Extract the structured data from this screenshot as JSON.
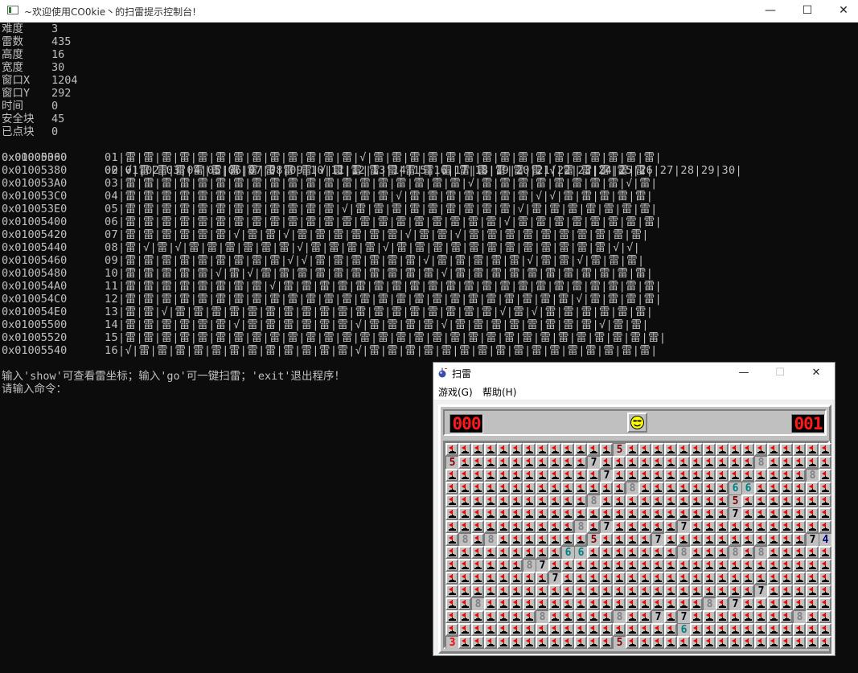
{
  "console": {
    "title": "~欢迎使用CO0kie丶的扫雷提示控制台!",
    "minimize": "—",
    "maximize": "☐",
    "close": "✕",
    "info": [
      {
        "label": "难度",
        "value": "3"
      },
      {
        "label": "雷数",
        "value": "435"
      },
      {
        "label": "高度",
        "value": "16"
      },
      {
        "label": "宽度",
        "value": "30"
      },
      {
        "label": "窗口X",
        "value": "1204"
      },
      {
        "label": "窗口Y",
        "value": "292"
      },
      {
        "label": "时间",
        "value": "0"
      },
      {
        "label": "安全块",
        "value": "45"
      },
      {
        "label": "已点块",
        "value": "0"
      }
    ],
    "grid_header": {
      "address": "0x00000000",
      "cells": "00|01|02|03|04|05|06|07|08|09|10|11|12|13|14|15|16|17|18|19|20|21|22|23|24|25|26|27|28|29|30|"
    },
    "grid_rows": [
      {
        "address": "0x01005360",
        "cells": "01|雷|雷|雷|雷|雷|雷|雷|雷|雷|雷|雷|雷|雷|√|雷|雷|雷|雷|雷|雷|雷|雷|雷|雷|雷|雷|雷|雷|雷|雷|"
      },
      {
        "address": "0x01005380",
        "cells": "02|√|雷|雷|雷|雷|雷|雷|雷|雷|雷|雷|√|雷|雷|雷|雷|雷|雷|雷|雷|雷|雷|雷|雷|√|雷|雷|雷|雷|雷|"
      },
      {
        "address": "0x010053A0",
        "cells": "03|雷|雷|雷|雷|雷|雷|雷|雷|雷|雷|雷|雷|雷|雷|雷|雷|雷|雷|雷|√|雷|雷|雷|雷|雷|雷|雷|雷|√|雷|"
      },
      {
        "address": "0x010053C0",
        "cells": "04|雷|雷|雷|雷|雷|雷|雷|雷|雷|雷|雷|雷|雷|雷|雷|√|雷|雷|雷|雷|雷|雷|雷|√|√|雷|雷|雷|雷|雷|"
      },
      {
        "address": "0x010053E0",
        "cells": "05|雷|雷|雷|雷|雷|雷|雷|雷|雷|雷|雷|雷|√|雷|雷|雷|雷|雷|雷|雷|雷|雷|√|雷|雷|雷|雷|雷|雷|雷|"
      },
      {
        "address": "0x01005400",
        "cells": "06|雷|雷|雷|雷|雷|雷|雷|雷|雷|雷|雷|雷|雷|雷|雷|雷|雷|雷|雷|雷|雷|√|雷|雷|雷|雷|雷|雷|雷|雷|"
      },
      {
        "address": "0x01005420",
        "cells": "07|雷|雷|雷|雷|雷|雷|√|雷|雷|√|雷|雷|雷|雷|雷|雷|√|雷|雷|√|雷|雷|雷|雷|雷|雷|雷|雷|雷|雷|"
      },
      {
        "address": "0x01005440",
        "cells": "08|雷|√|雷|√|雷|雷|雷|雷|雷|雷|√|雷|雷|雷|雷|√|雷|雷|雷|雷|雷|雷|雷|雷|雷|雷|雷|雷|√|√|"
      },
      {
        "address": "0x01005460",
        "cells": "09|雷|雷|雷|雷|雷|雷|雷|雷|雷|√|√|雷|雷|雷|雷|雷|雷|√|雷|雷|雷|雷|雷|√|雷|雷|√|雷|雷|雷|"
      },
      {
        "address": "0x01005480",
        "cells": "10|雷|雷|雷|雷|雷|√|雷|√|雷|雷|雷|雷|雷|雷|雷|雷|雷|雷|√|雷|雷|雷|雷|雷|雷|雷|雷|雷|雷|雷|"
      },
      {
        "address": "0x010054A0",
        "cells": "11|雷|雷|雷|雷|雷|雷|雷|雷|√|雷|雷|雷|雷|雷|雷|雷|雷|雷|雷|雷|雷|雷|雷|雷|雷|雷|雷|雷|雷|雷|"
      },
      {
        "address": "0x010054C0",
        "cells": "12|雷|雷|雷|雷|雷|雷|雷|雷|雷|雷|雷|雷|雷|雷|雷|雷|雷|雷|雷|雷|雷|雷|雷|雷|雷|√|雷|雷|雷|雷|"
      },
      {
        "address": "0x010054E0",
        "cells": "13|雷|雷|√|雷|雷|雷|雷|雷|雷|雷|雷|雷|雷|雷|雷|雷|雷|雷|雷|雷|雷|√|雷|√|雷|雷|雷|雷|雷|雷|"
      },
      {
        "address": "0x01005500",
        "cells": "14|雷|雷|雷|雷|雷|雷|√|雷|雷|雷|雷|雷|雷|√|雷|雷|雷|雷|√|雷|雷|雷|雷|雷|雷|雷|雷|√|雷|雷|"
      },
      {
        "address": "0x01005520",
        "cells": "15|雷|雷|雷|雷|雷|雷|雷|雷|雷|雷|雷|雷|雷|雷|雷|雷|雷|雷|雷|雷|雷|雷|雷|雷|雷|雷|雷|雷|雷|雷|"
      },
      {
        "address": "0x01005540",
        "cells": "16|√|雷|雷|雷|雷|雷|雷|雷|雷|雷|雷|雷|雷|√|雷|雷|雷|雷|雷|雷|雷|雷|雷|雷|雷|雷|雷|雷|雷|雷|"
      }
    ],
    "prompt_line": "输入'show'可查看雷坐标；输入'go'可一键扫雷；'exit'退出程序！",
    "input_line": "请输入命令："
  },
  "minesweeper": {
    "title": "扫雷",
    "minimize": "—",
    "maximize": "☐",
    "close": "✕",
    "menu": [
      "游戏(G)",
      "帮助(H)"
    ],
    "mine_counter": "000",
    "timer": "001",
    "face_icon": "smiley-face-icon",
    "flag_icon": "flag-icon",
    "number_colors": {
      "3": "#ff0000",
      "4": "#000080",
      "5": "#800000",
      "6": "#008080",
      "7": "#000000",
      "8": "#808080"
    },
    "board_rows": [
      [
        "F",
        "F",
        "F",
        "F",
        "F",
        "F",
        "F",
        "F",
        "F",
        "F",
        "F",
        "F",
        "F",
        "5",
        "F",
        "F",
        "F",
        "F",
        "F",
        "F",
        "F",
        "F",
        "F",
        "F",
        "F",
        "F",
        "F",
        "F",
        "F",
        "F"
      ],
      [
        "5",
        "F",
        "F",
        "F",
        "F",
        "F",
        "F",
        "F",
        "F",
        "F",
        "F",
        "7",
        "F",
        "F",
        "F",
        "F",
        "F",
        "F",
        "F",
        "F",
        "F",
        "F",
        "F",
        "F",
        "8",
        "F",
        "F",
        "F",
        "F",
        "F"
      ],
      [
        "F",
        "F",
        "F",
        "F",
        "F",
        "F",
        "F",
        "F",
        "F",
        "F",
        "F",
        "F",
        "7",
        "F",
        "F",
        "F",
        "F",
        "F",
        "F",
        "F",
        "F",
        "F",
        "F",
        "F",
        "F",
        "F",
        "F",
        "F",
        "8",
        "F"
      ],
      [
        "F",
        "F",
        "F",
        "F",
        "F",
        "F",
        "F",
        "F",
        "F",
        "F",
        "F",
        "F",
        "F",
        "F",
        "8",
        "F",
        "F",
        "F",
        "F",
        "F",
        "F",
        "F",
        "6",
        "6",
        "F",
        "F",
        "F",
        "F",
        "F",
        "F"
      ],
      [
        "F",
        "F",
        "F",
        "F",
        "F",
        "F",
        "F",
        "F",
        "F",
        "F",
        "F",
        "8",
        "F",
        "F",
        "F",
        "F",
        "F",
        "F",
        "F",
        "F",
        "F",
        "F",
        "5",
        "F",
        "F",
        "F",
        "F",
        "F",
        "F",
        "F"
      ],
      [
        "F",
        "F",
        "F",
        "F",
        "F",
        "F",
        "F",
        "F",
        "F",
        "F",
        "F",
        "F",
        "F",
        "F",
        "F",
        "F",
        "F",
        "F",
        "F",
        "F",
        "F",
        "F",
        "7",
        "F",
        "F",
        "F",
        "F",
        "F",
        "F",
        "F"
      ],
      [
        "F",
        "F",
        "F",
        "F",
        "F",
        "F",
        "F",
        "F",
        "F",
        "F",
        "8",
        "F",
        "7",
        "F",
        "F",
        "F",
        "F",
        "F",
        "7",
        "F",
        "F",
        "F",
        "F",
        "F",
        "F",
        "F",
        "F",
        "F",
        "F",
        "F"
      ],
      [
        "F",
        "8",
        "F",
        "8",
        "F",
        "F",
        "F",
        "F",
        "F",
        "F",
        "F",
        "5",
        "F",
        "F",
        "F",
        "F",
        "7",
        "F",
        "F",
        "F",
        "F",
        "F",
        "F",
        "F",
        "F",
        "F",
        "F",
        "F",
        "7",
        "4"
      ],
      [
        "F",
        "F",
        "F",
        "F",
        "F",
        "F",
        "F",
        "F",
        "F",
        "6",
        "6",
        "F",
        "F",
        "F",
        "F",
        "F",
        "F",
        "F",
        "8",
        "F",
        "F",
        "F",
        "8",
        "F",
        "8",
        "F",
        "F",
        "F",
        "F",
        "F"
      ],
      [
        "F",
        "F",
        "F",
        "F",
        "F",
        "F",
        "8",
        "7",
        "F",
        "F",
        "F",
        "F",
        "F",
        "F",
        "F",
        "F",
        "F",
        "F",
        "F",
        "F",
        "F",
        "F",
        "F",
        "F",
        "F",
        "F",
        "F",
        "F",
        "F",
        "F"
      ],
      [
        "F",
        "F",
        "F",
        "F",
        "F",
        "F",
        "F",
        "F",
        "7",
        "F",
        "F",
        "F",
        "F",
        "F",
        "F",
        "F",
        "F",
        "F",
        "F",
        "F",
        "F",
        "F",
        "F",
        "F",
        "F",
        "F",
        "F",
        "F",
        "F",
        "F"
      ],
      [
        "F",
        "F",
        "F",
        "F",
        "F",
        "F",
        "F",
        "F",
        "F",
        "F",
        "F",
        "F",
        "F",
        "F",
        "F",
        "F",
        "F",
        "F",
        "F",
        "F",
        "F",
        "F",
        "F",
        "F",
        "7",
        "F",
        "F",
        "F",
        "F",
        "F"
      ],
      [
        "F",
        "F",
        "8",
        "F",
        "F",
        "F",
        "F",
        "F",
        "F",
        "F",
        "F",
        "F",
        "F",
        "F",
        "F",
        "F",
        "F",
        "F",
        "F",
        "F",
        "8",
        "F",
        "7",
        "F",
        "F",
        "F",
        "F",
        "F",
        "F",
        "F"
      ],
      [
        "F",
        "F",
        "F",
        "F",
        "F",
        "F",
        "F",
        "8",
        "F",
        "F",
        "F",
        "F",
        "F",
        "8",
        "F",
        "F",
        "7",
        "F",
        "7",
        "F",
        "F",
        "F",
        "F",
        "F",
        "F",
        "F",
        "F",
        "8",
        "F",
        "F"
      ],
      [
        "F",
        "F",
        "F",
        "F",
        "F",
        "F",
        "F",
        "F",
        "F",
        "F",
        "F",
        "F",
        "F",
        "F",
        "F",
        "F",
        "F",
        "F",
        "6",
        "F",
        "F",
        "F",
        "F",
        "F",
        "F",
        "F",
        "F",
        "F",
        "F",
        "F"
      ],
      [
        "3",
        "F",
        "F",
        "F",
        "F",
        "F",
        "F",
        "F",
        "F",
        "F",
        "F",
        "F",
        "F",
        "5",
        "F",
        "F",
        "F",
        "F",
        "F",
        "F",
        "F",
        "F",
        "F",
        "F",
        "F",
        "F",
        "F",
        "F",
        "F",
        "F"
      ]
    ]
  }
}
